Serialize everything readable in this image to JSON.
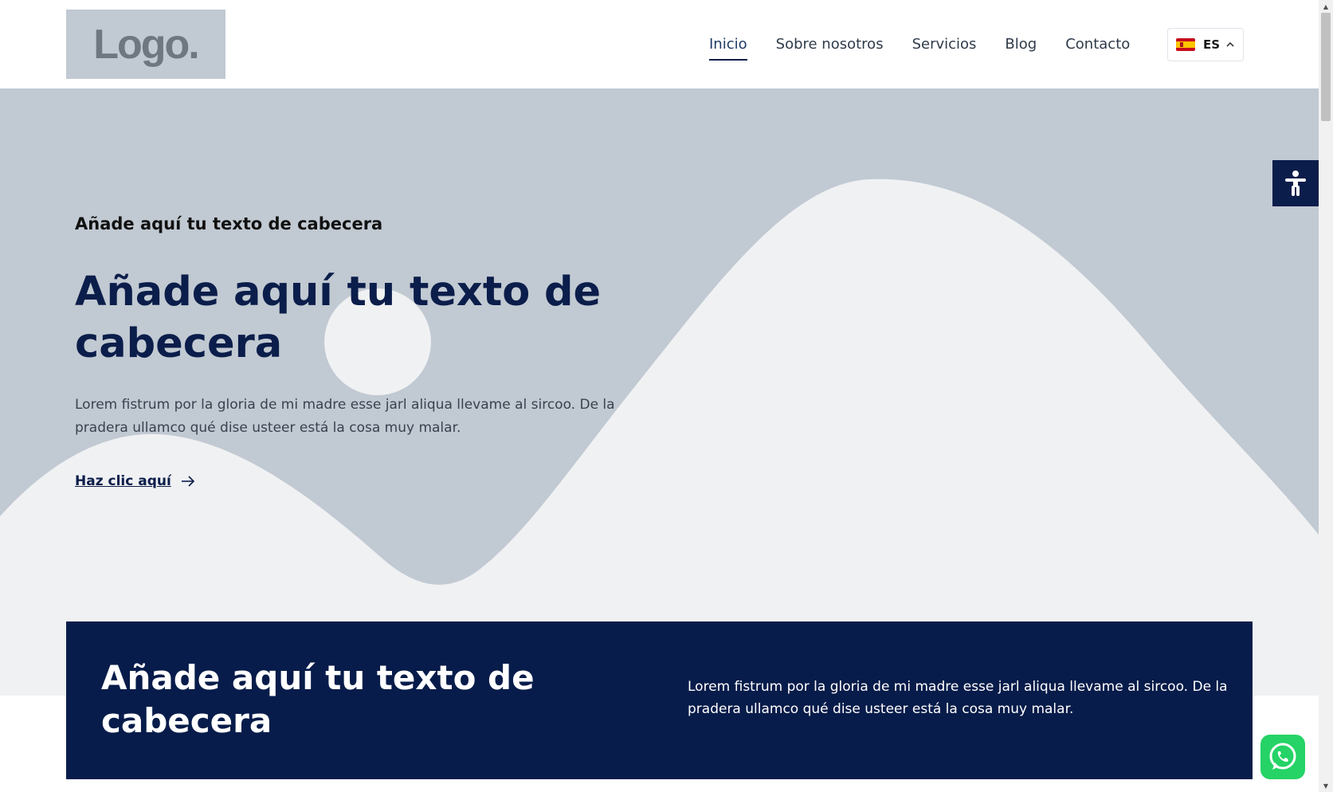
{
  "header": {
    "logo_text": "Logo.",
    "nav": [
      {
        "label": "Inicio",
        "active": true
      },
      {
        "label": "Sobre nosotros",
        "active": false
      },
      {
        "label": "Servicios",
        "active": false
      },
      {
        "label": "Blog",
        "active": false
      },
      {
        "label": "Contacto",
        "active": false
      }
    ],
    "language": {
      "code": "ES",
      "flag_icon": "spain-flag-icon"
    }
  },
  "hero": {
    "kicker": "Añade aquí tu texto de cabecera",
    "title": "Añade aquí tu texto de cabecera",
    "text": "Lorem fistrum por la gloria de mi madre esse jarl aliqua llevame al sircoo. De la pradera ullamco qué dise usteer está la cosa muy malar.",
    "link_label": "Haz clic aquí"
  },
  "card": {
    "title": "Añade aquí tu texto de cabecera",
    "text": "Lorem fistrum por la gloria de mi madre esse jarl aliqua llevame al sircoo. De la pradera ullamco qué dise usteer está la cosa muy malar."
  },
  "widgets": {
    "accessibility_icon": "accessibility-icon",
    "whatsapp_icon": "whatsapp-icon"
  },
  "colors": {
    "primary": "#0b1d4a",
    "hero_bg": "#c1c9d2",
    "wave": "#f0f1f3",
    "whatsapp": "#25d366"
  }
}
